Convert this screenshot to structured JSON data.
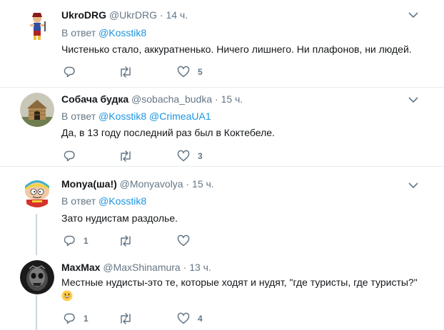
{
  "tweets": [
    {
      "name": "UkroDRG",
      "handle": "@UkrDRG",
      "dot": "·",
      "time": "14 ч.",
      "reply_prefix": "В ответ",
      "mentions": [
        "@Kosstik8"
      ],
      "text": "Чистенько стало, аккуратненько. Ничего лишнего. Ни плафонов, ни людей.",
      "replies": "",
      "retweets": "",
      "likes": "5"
    },
    {
      "name": "Собача будка",
      "handle": "@sobacha_budka",
      "dot": "·",
      "time": "15 ч.",
      "reply_prefix": "В ответ",
      "mentions": [
        "@Kosstik8",
        "@CrimeaUA1"
      ],
      "text": "Да, в 13 году последний раз был в Коктебеле.",
      "replies": "",
      "retweets": "",
      "likes": "3"
    },
    {
      "name": "Monya(ша!)",
      "handle": "@Monyavolya",
      "dot": "·",
      "time": "15 ч.",
      "reply_prefix": "В ответ",
      "mentions": [
        "@Kosstik8"
      ],
      "text": "Зато нудистам раздолье.",
      "replies": "1",
      "retweets": "",
      "likes": ""
    },
    {
      "name": "MaxMax",
      "handle": "@MaxShinamura",
      "dot": "·",
      "time": "13 ч.",
      "text": "Местные нудисты-это те, которые ходят и нудят, \"где туристы, где туристы?\"",
      "emoji": "grinning-face",
      "replies": "1",
      "retweets": "",
      "likes": "4"
    }
  ],
  "colors": {
    "link": "#1b95e0",
    "secondary_text": "#657786",
    "separator": "#e6ecf0",
    "thread_line": "#ccd6dd"
  }
}
